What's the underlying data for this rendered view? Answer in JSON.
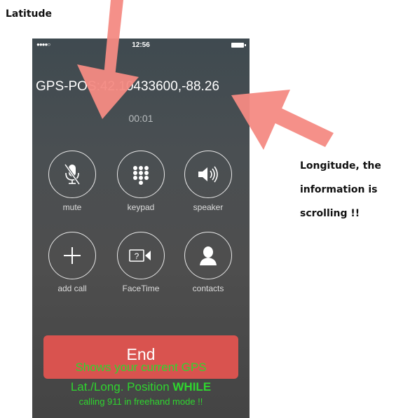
{
  "annotations": {
    "latitude_note": "Latitude",
    "longitude_note_lines": [
      "Longitude, the",
      "information is",
      "scrolling !!"
    ]
  },
  "status_bar": {
    "signal": "●●●●○",
    "time": "12:56"
  },
  "call": {
    "caller_id": "GPS-POS:42.10433600,-88.26",
    "timer": "00:01"
  },
  "controls": [
    {
      "label": "mute",
      "icon": "microphone-muted-icon"
    },
    {
      "label": "keypad",
      "icon": "keypad-icon"
    },
    {
      "label": "speaker",
      "icon": "speaker-icon"
    },
    {
      "label": "add call",
      "icon": "plus-icon"
    },
    {
      "label": "FaceTime",
      "icon": "facetime-icon"
    },
    {
      "label": "contacts",
      "icon": "contact-person-icon"
    }
  ],
  "end_button": {
    "label": "End"
  },
  "overlay_text": {
    "line1": "Shows your current GPS",
    "line2_prefix": "Lat./Long. Position ",
    "line2_bold": "WHILE",
    "line3": "calling 911 in freehand mode !!"
  },
  "colors": {
    "end_button": "#d9534f",
    "overlay_text": "#2fd52f",
    "arrows": "#f58b83"
  }
}
